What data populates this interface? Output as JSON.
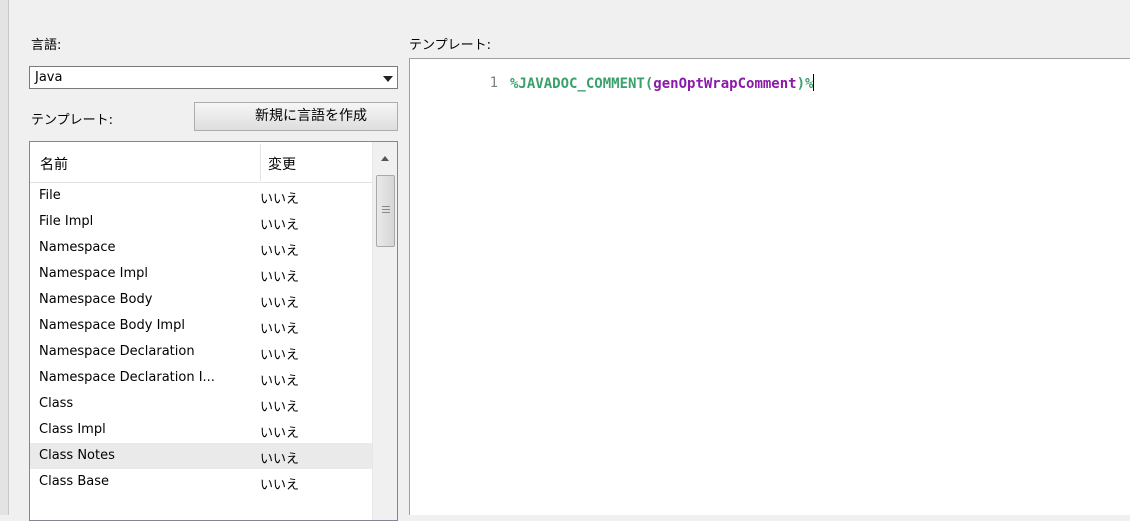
{
  "left_panel": {
    "language_label": "言語:",
    "language_select": {
      "value": "Java"
    },
    "template_label": "テンプレート:",
    "new_language_button": "新規に言語を作成",
    "list": {
      "columns": [
        "名前",
        "変更"
      ],
      "rows": [
        {
          "name": "File",
          "changed": "いいえ"
        },
        {
          "name": "File Impl",
          "changed": "いいえ"
        },
        {
          "name": "Namespace",
          "changed": "いいえ"
        },
        {
          "name": "Namespace Impl",
          "changed": "いいえ"
        },
        {
          "name": "Namespace Body",
          "changed": "いいえ"
        },
        {
          "name": "Namespace Body Impl",
          "changed": "いいえ"
        },
        {
          "name": "Namespace Declaration",
          "changed": "いいえ"
        },
        {
          "name": "Namespace Declaration I...",
          "changed": "いいえ"
        },
        {
          "name": "Class",
          "changed": "いいえ"
        },
        {
          "name": "Class Impl",
          "changed": "いいえ"
        },
        {
          "name": "Class Notes",
          "changed": "いいえ",
          "selected": true
        },
        {
          "name": "Class Base",
          "changed": "いいえ"
        }
      ]
    }
  },
  "right_panel": {
    "template_label": "テンプレート:",
    "editor": {
      "line_number": "1",
      "code_prefix": "%JAVADOC_COMMENT(",
      "code_arg": "genOptWrapComment",
      "code_suffix": ")%"
    }
  },
  "icons": {
    "dropdown": "chevron-down-icon",
    "scroll_up": "arrow-up-icon",
    "scroll_thumb": "scrollbar-thumb"
  },
  "colors": {
    "macro": "#3aa06c",
    "argument": "#8b1aa8",
    "line_number": "#808080",
    "selected_row": "#eaeaea"
  }
}
